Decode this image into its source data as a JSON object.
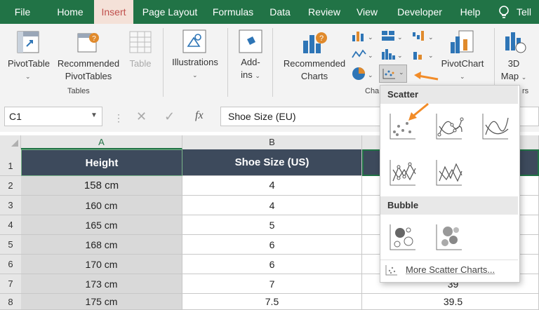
{
  "menu": {
    "items": [
      {
        "label": "File",
        "active": false
      },
      {
        "label": "Home",
        "active": false
      },
      {
        "label": "Insert",
        "active": true
      },
      {
        "label": "Page Layout",
        "active": false
      },
      {
        "label": "Formulas",
        "active": false
      },
      {
        "label": "Data",
        "active": false
      },
      {
        "label": "Review",
        "active": false
      },
      {
        "label": "View",
        "active": false
      },
      {
        "label": "Developer",
        "active": false
      },
      {
        "label": "Help",
        "active": false
      }
    ],
    "tell_label": "Tell"
  },
  "ribbon": {
    "pivottable": "PivotTable",
    "recommended_pivottables_line1": "Recommended",
    "recommended_pivottables_line2": "PivotTables",
    "table": "Table",
    "tables_group": "Tables",
    "illustrations": "Illustrations",
    "addins_line1": "Add-",
    "addins_line2": "ins",
    "recommended_charts_line1": "Recommended",
    "recommended_charts_line2": "Charts",
    "charts_group_partial": "Cha",
    "pivotchart": "PivotChart",
    "map3d_line1": "3D",
    "map3d_line2": "Map",
    "tours_group_partial": "rs"
  },
  "formula_bar": {
    "name_box": "C1",
    "fx": "fx",
    "content": "Shoe Size (EU)"
  },
  "sheet": {
    "columns": [
      "A",
      "B"
    ],
    "rows": [
      {
        "num": "1",
        "a": "Height",
        "b": "Shoe Size (US)",
        "c": ""
      },
      {
        "num": "2",
        "a": "158 cm",
        "b": "4",
        "c": ""
      },
      {
        "num": "3",
        "a": "160 cm",
        "b": "4",
        "c": ""
      },
      {
        "num": "4",
        "a": "165 cm",
        "b": "5",
        "c": ""
      },
      {
        "num": "5",
        "a": "168 cm",
        "b": "6",
        "c": ""
      },
      {
        "num": "6",
        "a": "170 cm",
        "b": "6",
        "c": ""
      },
      {
        "num": "7",
        "a": "173 cm",
        "b": "7",
        "c": "39"
      },
      {
        "num": "8",
        "a": "175 cm",
        "b": "7.5",
        "c": "39.5"
      }
    ]
  },
  "dropdown": {
    "scatter_header": "Scatter",
    "bubble_header": "Bubble",
    "more_link": "More Scatter Charts...",
    "scatter_icons": [
      "scatter-markers-only-icon",
      "scatter-smooth-lines-markers-icon",
      "scatter-smooth-lines-icon",
      "scatter-straight-lines-markers-icon",
      "scatter-straight-lines-icon"
    ],
    "bubble_icons": [
      "bubble-icon",
      "bubble-3d-icon"
    ]
  },
  "colors": {
    "menu_bg": "#217346",
    "active_tab_bg": "#f4e1d8",
    "header_cell_bg": "#3d4a5c",
    "arrow": "#f28c28"
  }
}
